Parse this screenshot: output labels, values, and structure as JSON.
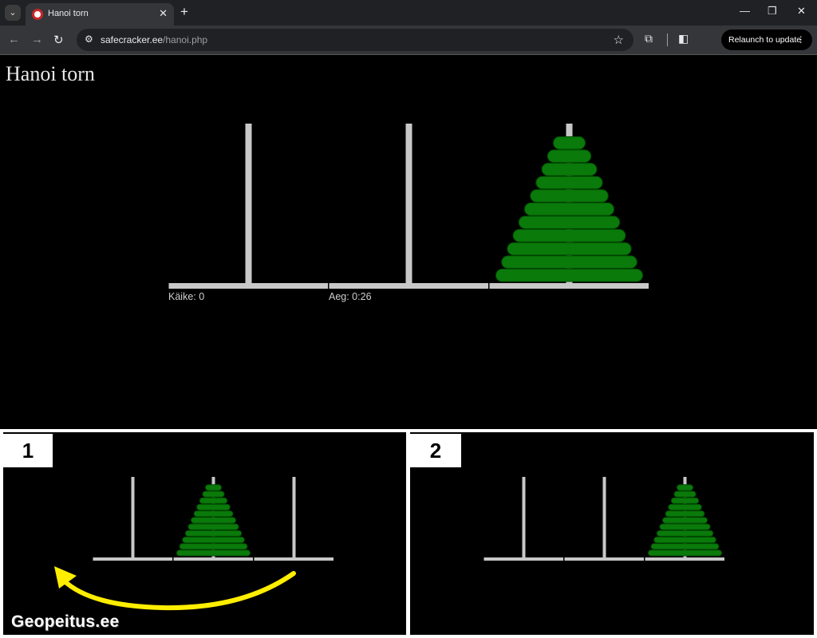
{
  "browser": {
    "tab_title": "Hanoi torn",
    "tab_close": "✕",
    "new_tab": "+",
    "url_domain": "safecracker.ee",
    "url_path": "/hanoi.php",
    "relaunch_label": "Relaunch to update",
    "window_controls": [
      "minimize-icon",
      "restore-icon",
      "close-icon"
    ]
  },
  "page": {
    "title": "Hanoi torn",
    "moves_label": "Käike: 0",
    "time_label": "Aeg: 0:26",
    "disk_color": "#0a7a0a",
    "rod_color": "#c8c8c8",
    "main_state": {
      "pegs": [
        0,
        0,
        11
      ]
    }
  },
  "panels": [
    {
      "number": "1",
      "pegs": [
        0,
        11,
        0
      ],
      "arrow_color": "#ffee00"
    },
    {
      "number": "2",
      "pegs": [
        0,
        0,
        11
      ]
    }
  ],
  "watermark": "Geopeitus.ee"
}
